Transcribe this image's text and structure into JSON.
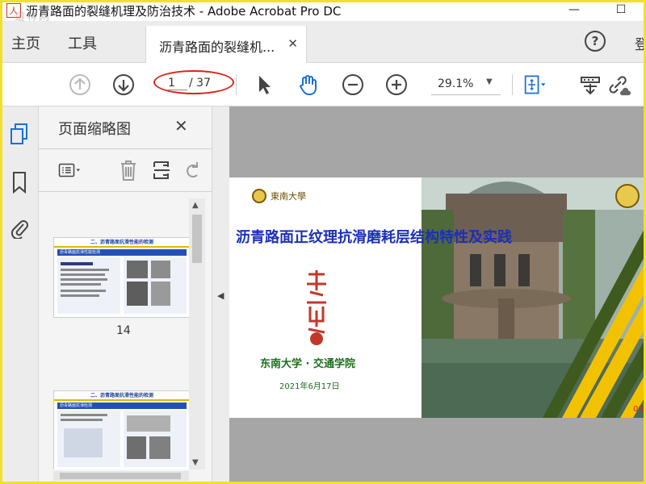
{
  "window": {
    "title": "沥青路面的裂缝机理及防治技术 - Adobe Acrobat Pro DC",
    "app_icon": "人",
    "minimize_glyph": "—",
    "maximize_glyph": "☐",
    "watermark": "道林网"
  },
  "nav": {
    "home": "主页",
    "tools": "工具",
    "doc_tab": "沥青路面的裂缝机...",
    "doc_tab_close": "✕",
    "help": "?",
    "login": "登"
  },
  "toolbar": {
    "page_current": "1",
    "page_total": "/ 37",
    "zoom": "29.1%",
    "zoom_caret": "▼",
    "icons": [
      "prev-page-icon",
      "next-page-icon",
      "select-arrow-icon",
      "hand-icon",
      "zoom-out-icon",
      "zoom-in-icon",
      "fit-page-icon",
      "scroll-mode-icon",
      "link-icon"
    ]
  },
  "panel": {
    "title": "页面缩略图",
    "close": "✕",
    "thumbnails": [
      {
        "number": "14",
        "heading": "二、沥青路面抗滑性能的检测",
        "sub": "沥青路面抗滑性能检测"
      },
      {
        "number": "",
        "heading": "二、沥青路面抗滑性能的检测",
        "sub": "沥青路面抗滑检测"
      }
    ]
  },
  "slide": {
    "university": "東南大學",
    "title": "沥青路面正纹理抗滑磨耗层结构特性及实践",
    "school": "东南大学 · 交通学院",
    "date": "2021年6月17日",
    "page_num": "09"
  },
  "colors": {
    "title_blue": "#1c2fb8",
    "school_green": "#1d6e1d",
    "stripe_yellow": "#f2c200",
    "stripe_green": "#3e5a1e",
    "annotation_red": "#d9241b",
    "frame_yellow": "#f4df2a"
  }
}
